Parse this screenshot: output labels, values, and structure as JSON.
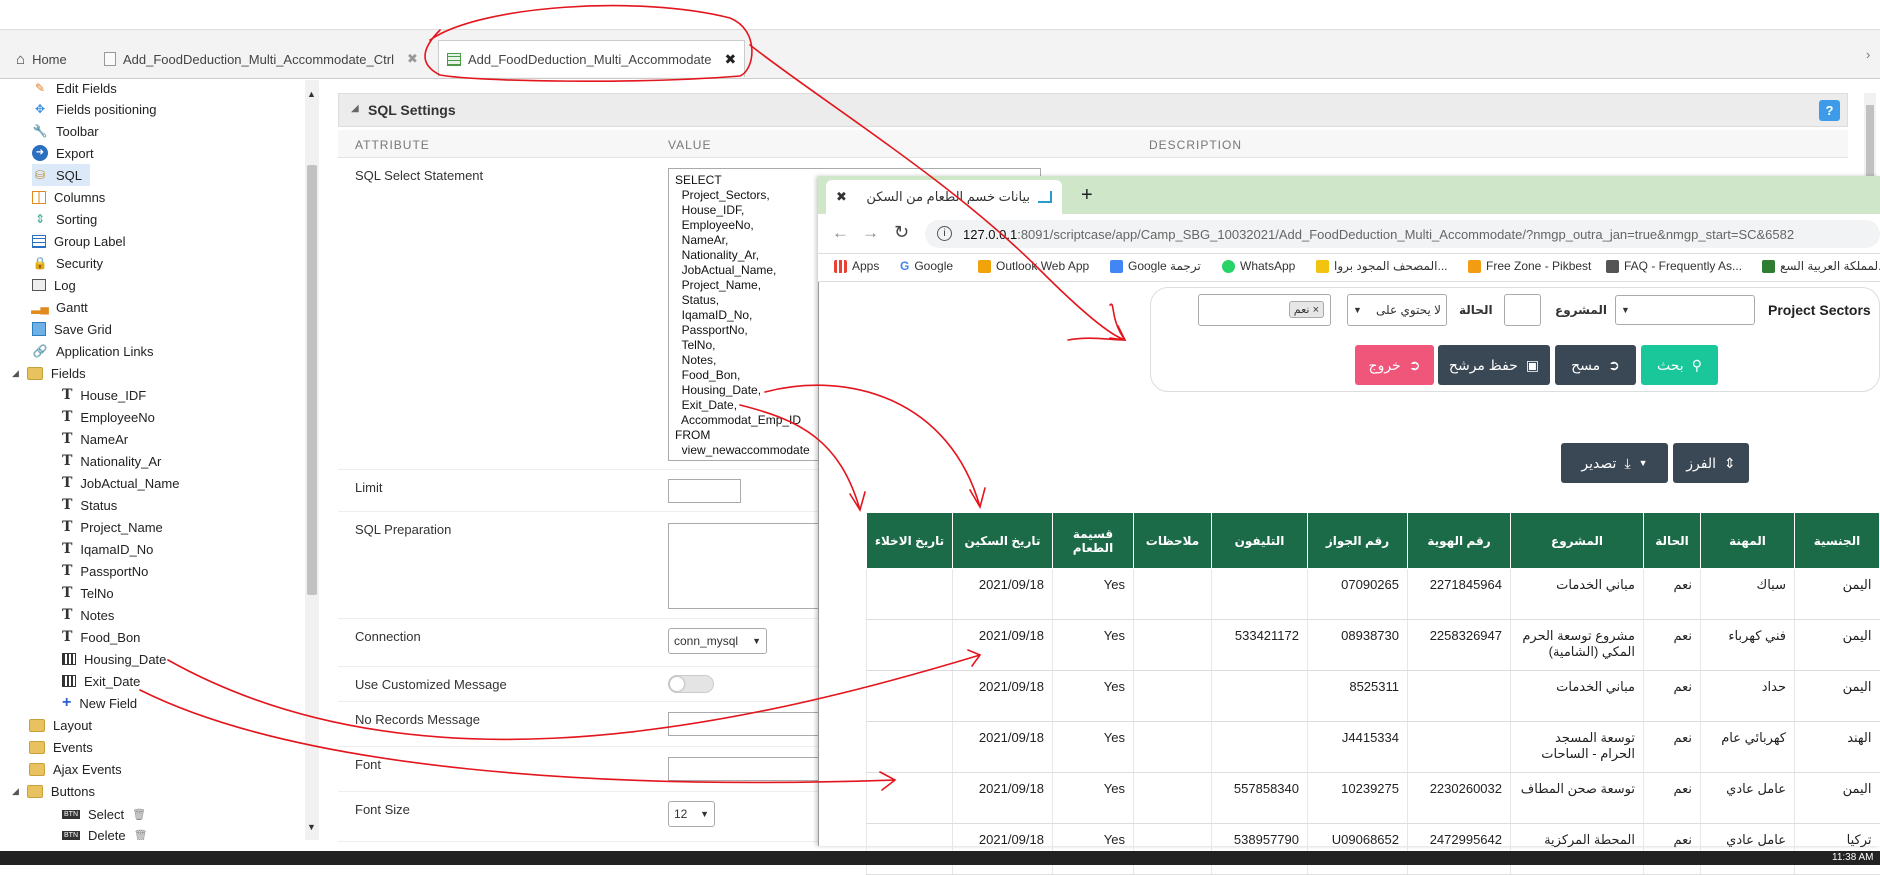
{
  "tabs": [
    {
      "label": "Home",
      "icon": "home-icon"
    },
    {
      "label": "Add_FoodDeduction_Multi_Accommodate_Ctrl",
      "icon": "form-icon"
    },
    {
      "label": "Add_FoodDeduction_Multi_Accommodate",
      "icon": "grid-icon"
    }
  ],
  "sidebar": {
    "items": [
      {
        "label": "Edit Fields",
        "icon": "edit-fields-icon"
      },
      {
        "label": "Fields positioning",
        "icon": "move-icon"
      },
      {
        "label": "Toolbar",
        "icon": "wrench-icon"
      },
      {
        "label": "Export",
        "icon": "export-icon"
      },
      {
        "label": "SQL",
        "icon": "database-icon"
      },
      {
        "label": "Columns",
        "icon": "columns-icon"
      },
      {
        "label": "Sorting",
        "icon": "sort-icon"
      },
      {
        "label": "Group Label",
        "icon": "table-icon"
      },
      {
        "label": "Security",
        "icon": "lock-icon"
      },
      {
        "label": "Log",
        "icon": "log-icon"
      },
      {
        "label": "Gantt",
        "icon": "gantt-icon"
      },
      {
        "label": "Save Grid",
        "icon": "save-icon"
      },
      {
        "label": "Application Links",
        "icon": "link-icon"
      },
      {
        "label": "Fields",
        "icon": "folder-icon"
      }
    ],
    "fields": [
      {
        "label": "House_IDF",
        "type": "text"
      },
      {
        "label": "EmployeeNo",
        "type": "text"
      },
      {
        "label": "NameAr",
        "type": "text"
      },
      {
        "label": "Nationality_Ar",
        "type": "text"
      },
      {
        "label": "JobActual_Name",
        "type": "text"
      },
      {
        "label": "Status",
        "type": "text"
      },
      {
        "label": "Project_Name",
        "type": "text"
      },
      {
        "label": "IqamaID_No",
        "type": "text"
      },
      {
        "label": "PassportNo",
        "type": "text"
      },
      {
        "label": "TelNo",
        "type": "text"
      },
      {
        "label": "Notes",
        "type": "text"
      },
      {
        "label": "Food_Bon",
        "type": "text"
      },
      {
        "label": "Housing_Date",
        "type": "date"
      },
      {
        "label": "Exit_Date",
        "type": "date"
      },
      {
        "label": "New Field",
        "type": "add"
      }
    ],
    "bottom": [
      {
        "label": "Layout"
      },
      {
        "label": "Events"
      },
      {
        "label": "Ajax Events"
      },
      {
        "label": "Buttons"
      }
    ],
    "buttons": [
      {
        "label": "Select"
      },
      {
        "label": "Delete"
      }
    ]
  },
  "panel": {
    "title": "SQL Settings",
    "help": "?",
    "col_attribute": "ATTRIBUTE",
    "col_value": "VALUE",
    "col_description": "DESCRIPTION",
    "sql_label": "SQL Select Statement",
    "sql_text": "SELECT\n  Project_Sectors,\n  House_IDF,\n  EmployeeNo,\n  NameAr,\n  Nationality_Ar,\n  JobActual_Name,\n  Project_Name,\n  Status,\n  IqamaID_No,\n  PassportNo,\n  TelNo,\n  Notes,\n  Food_Bon,\n  Housing_Date,\n  Exit_Date,\n  Accommodat_Emp_ID\nFROM\n  view_newaccommodate",
    "limit_label": "Limit",
    "prep_label": "SQL Preparation",
    "connection_label": "Connection",
    "connection_value": "conn_mysql",
    "custom_msg_label": "Use Customized Message",
    "norec_label": "No Records Message",
    "font_label": "Font",
    "fontsize_label": "Font Size",
    "fontsize_value": "12"
  },
  "browser": {
    "tab_title": "بيانات خسم الطعام من السكن",
    "url_host": "127.0.0.1",
    "url_rest": ":8091/scriptcase/app/Camp_SBG_10032021/Add_FoodDeduction_Multi_Accommodate/?nmgp_outra_jan=true&nmgp_start=SC&6582",
    "bookmarks": [
      {
        "label": "Apps",
        "color": "#e94235"
      },
      {
        "label": "Google",
        "color": "#4285f4"
      },
      {
        "label": "Outlook Web App",
        "color": "#f0a30a"
      },
      {
        "label": "Google ترجمة",
        "color": "#4285f4"
      },
      {
        "label": "WhatsApp",
        "color": "#25d366"
      },
      {
        "label": "المصحف المجود بروا...",
        "color": "#f1c40f"
      },
      {
        "label": "Free Zone - Pikbest",
        "color": "#f39c12"
      },
      {
        "label": "FAQ - Frequently As...",
        "color": "#555555"
      },
      {
        "label": "لمملكة العربية السع...",
        "color": "#2e7d32"
      }
    ]
  },
  "filter": {
    "project_sectors_label": "Project Sectors",
    "project_label": "المشروع",
    "status_label": "الحالة",
    "status_op": "لا يحتوي على",
    "status_chip": "نعم",
    "btn_search": "بحث",
    "btn_clear": "مسح",
    "btn_save": "حفظ مرشح",
    "btn_exit": "خروج"
  },
  "toolbar": {
    "sort_label": "الفرز",
    "export_label": "تصدير"
  },
  "grid": {
    "headers": [
      "الجنسية",
      "المهنة",
      "الحالة",
      "المشروع",
      "رقم الهوية",
      "رقم الجواز",
      "التليفون",
      "ملاحظات",
      "قسيمة الطعام",
      "تاريخ السكين",
      "تاريخ الاخلاء"
    ],
    "rows": [
      [
        "اليمن",
        "سباك",
        "نعم",
        "مباني الخدمات",
        "2271845964",
        "07090265",
        "",
        "",
        "Yes",
        "2021/09/18",
        ""
      ],
      [
        "اليمن",
        "فني كهرباء",
        "نعم",
        "مشروع توسعة الحرم المكي (الشامية)",
        "2258326947",
        "08938730",
        "533421172",
        "",
        "Yes",
        "2021/09/18",
        ""
      ],
      [
        "اليمن",
        "حداد",
        "نعم",
        "مباني الخدمات",
        "",
        "8525311",
        "",
        "",
        "Yes",
        "2021/09/18",
        ""
      ],
      [
        "الهند",
        "كهربائي عام",
        "نعم",
        "توسعة المسجد الحرام - الساحات",
        "",
        "J4415334",
        "",
        "",
        "Yes",
        "2021/09/18",
        ""
      ],
      [
        "اليمن",
        "عامل عادي",
        "نعم",
        "توسعة صحن المطاف",
        "2230260032",
        "10239275",
        "557858340",
        "",
        "Yes",
        "2021/09/18",
        ""
      ],
      [
        "تركيا",
        "عامل عادي",
        "نعم",
        "المحطة المركزية",
        "2472995642",
        "U09068652",
        "538957790",
        "",
        "Yes",
        "2021/09/18",
        ""
      ]
    ]
  },
  "taskbar": {
    "time": "11:38 AM"
  }
}
